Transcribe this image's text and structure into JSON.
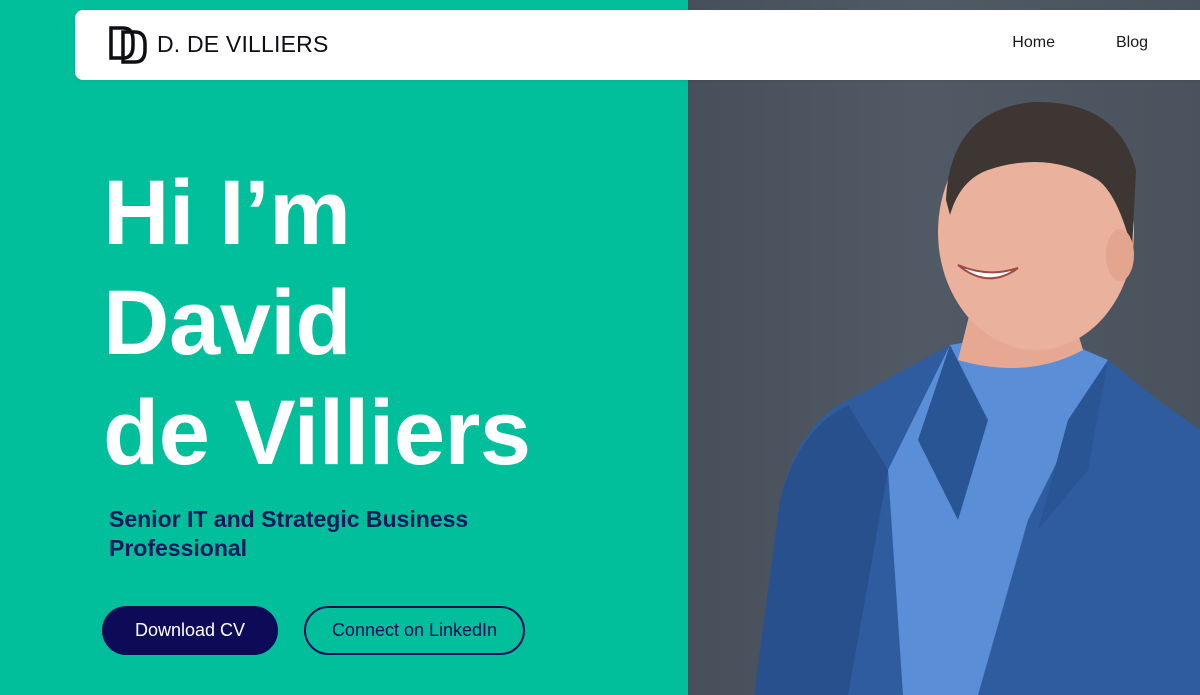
{
  "nav": {
    "brand_name": "D. DE VILLIERS",
    "links": [
      "Home",
      "Blog"
    ]
  },
  "hero": {
    "title_lines": [
      "Hi I’m",
      "David",
      "de Villiers"
    ],
    "subtitle": "Senior IT and Strategic Business Professional",
    "primary_button": "Download CV",
    "secondary_button": "Connect on LinkedIn"
  },
  "colors": {
    "accent_green": "#00bf9a",
    "navy": "#0d0b57",
    "photo_background": "#4d5660"
  },
  "icons": {
    "logo": "dd-monogram-logo"
  }
}
